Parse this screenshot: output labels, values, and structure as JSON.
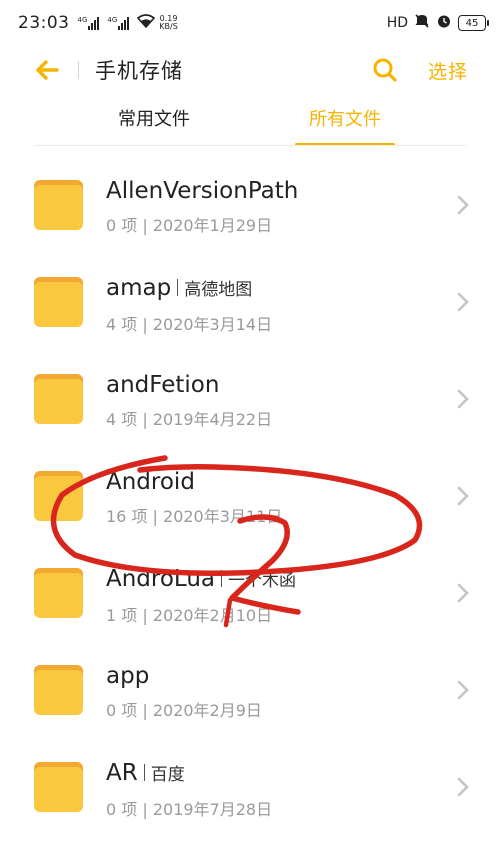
{
  "status_bar": {
    "time": "23:03",
    "signal1_tag": "4G",
    "signal2_tag": "4G",
    "network_speed_value": "0.19",
    "network_speed_unit": "KB/S",
    "hd_label": "HD",
    "battery_level": "45"
  },
  "header": {
    "title": "手机存储",
    "select_label": "选择",
    "accent_color": "#f5b400"
  },
  "tabs": [
    {
      "label": "常用文件",
      "active": false
    },
    {
      "label": "所有文件",
      "active": true
    }
  ],
  "folders": [
    {
      "name": "AllenVersionPath",
      "alias": "",
      "meta": "0 项 | 2020年1月29日"
    },
    {
      "name": "amap",
      "alias": "高德地图",
      "meta": "4 项 | 2020年3月14日"
    },
    {
      "name": "andFetion",
      "alias": "",
      "meta": "4 项 | 2019年4月22日"
    },
    {
      "name": "Android",
      "alias": "",
      "meta": "16 项 | 2020年3月11日"
    },
    {
      "name": "AndroLua",
      "alias": "一个木函",
      "meta": "1 项 | 2020年2月10日"
    },
    {
      "name": "app",
      "alias": "",
      "meta": "0 项 | 2020年2月9日"
    },
    {
      "name": "AR",
      "alias": "百度",
      "meta": "0 项 | 2019年7月28日"
    }
  ],
  "annotation": {
    "color": "#d9261c",
    "text": "2"
  }
}
